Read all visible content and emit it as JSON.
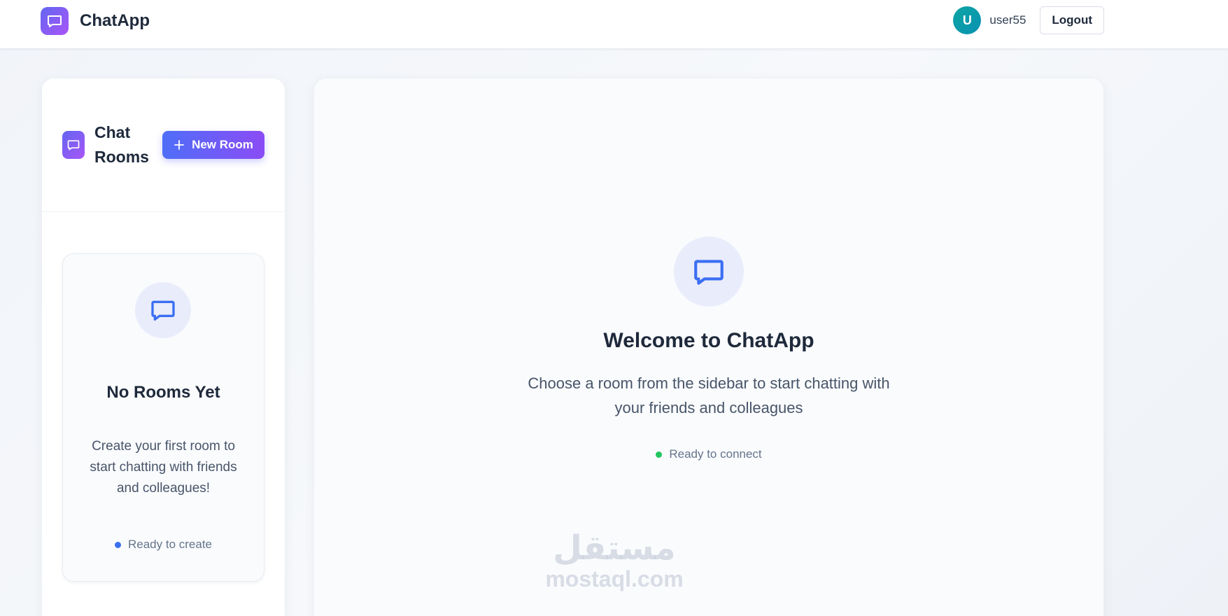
{
  "app": {
    "name": "ChatApp",
    "logo_icon": "chat-bubble-icon"
  },
  "user": {
    "avatar_initial": "U",
    "username": "user55",
    "logout_label": "Logout"
  },
  "sidebar": {
    "title": "Chat Rooms",
    "new_room_label": "New Room",
    "new_room_icon": "plus-icon",
    "empty_state": {
      "icon": "chat-bubble-icon",
      "title": "No Rooms Yet",
      "description": "Create your first room to start chatting with friends and colleagues!",
      "status": "Ready to create",
      "status_color": "#3b6ff2"
    }
  },
  "main": {
    "icon": "chat-bubble-icon",
    "title": "Welcome to ChatApp",
    "description": "Choose a room from the sidebar to start chatting with your friends and colleagues",
    "status": "Ready to connect",
    "status_color": "#22c55e"
  },
  "watermark": {
    "arabic": "مستقل",
    "domain": "mostaql.com"
  },
  "colors": {
    "accent_start": "#4f6ef7",
    "accent_end": "#8b4cf6",
    "icon_blue": "#3b6ff2",
    "avatar": "#0ea5a4"
  }
}
